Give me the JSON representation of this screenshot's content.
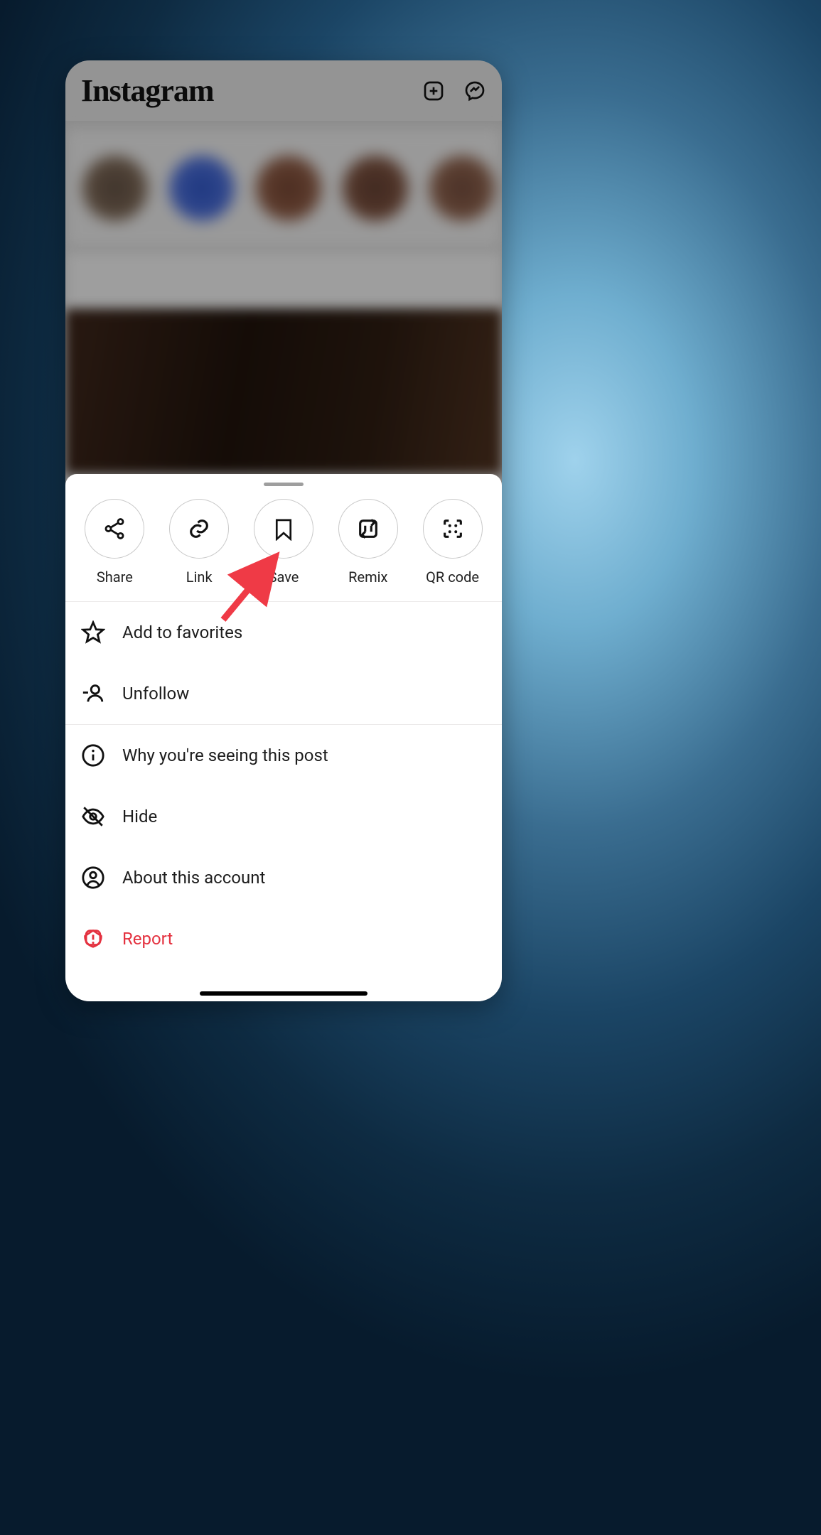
{
  "header": {
    "brand": "Instagram"
  },
  "top_actions": {
    "share": {
      "label": "Share"
    },
    "link": {
      "label": "Link"
    },
    "save": {
      "label": "Save"
    },
    "remix": {
      "label": "Remix"
    },
    "qrcode": {
      "label": "QR code"
    }
  },
  "menu": {
    "favorites": "Add to favorites",
    "unfollow": "Unfollow",
    "why": "Why you're seeing this post",
    "hide": "Hide",
    "about": "About this account",
    "report": "Report"
  },
  "annotation": {
    "target": "save"
  },
  "colors": {
    "danger": "#e4313f"
  }
}
